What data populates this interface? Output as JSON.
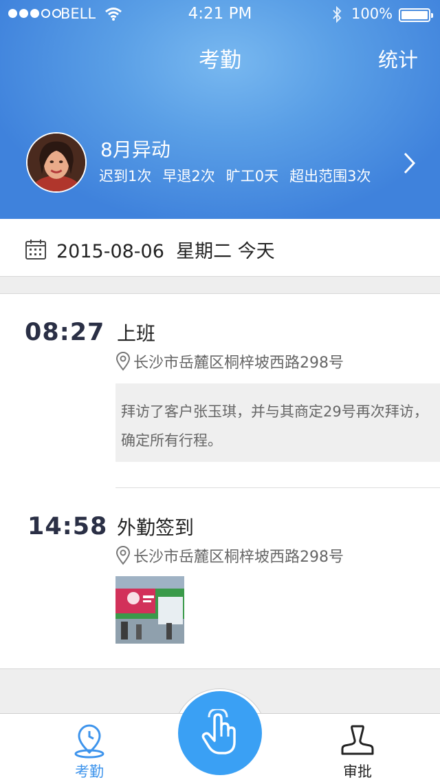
{
  "status_bar": {
    "carrier": "BELL",
    "time": "4:21 PM",
    "battery": "100%"
  },
  "nav": {
    "title": "考勤",
    "right_action": "统计"
  },
  "summary": {
    "title": "8月异动",
    "stats": [
      "迟到1次",
      "早退2次",
      "旷工0天",
      "超出范围3次"
    ]
  },
  "date_bar": {
    "text": "2015-08-06  星期二 今天"
  },
  "records": [
    {
      "time": "08:27",
      "title": "上班",
      "location": "长沙市岳麓区桐梓坡西路298号",
      "note": "拜访了客户张玉琪，并与其商定29号再次拜访，确定所有行程。"
    },
    {
      "time": "14:58",
      "title": "外勤签到",
      "location": "长沙市岳麓区桐梓坡西路298号"
    }
  ],
  "tab_bar": {
    "tabs": [
      {
        "label": "考勤",
        "icon": "clock-pin-icon",
        "active": true
      },
      {
        "label": "审批",
        "icon": "stamp-icon",
        "active": false
      }
    ],
    "center_button_icon": "hand-tap-icon"
  },
  "colors": {
    "header_blue": "#4a90e2",
    "accent_blue": "#3aa0f4",
    "active_tab": "#3e94ec"
  }
}
